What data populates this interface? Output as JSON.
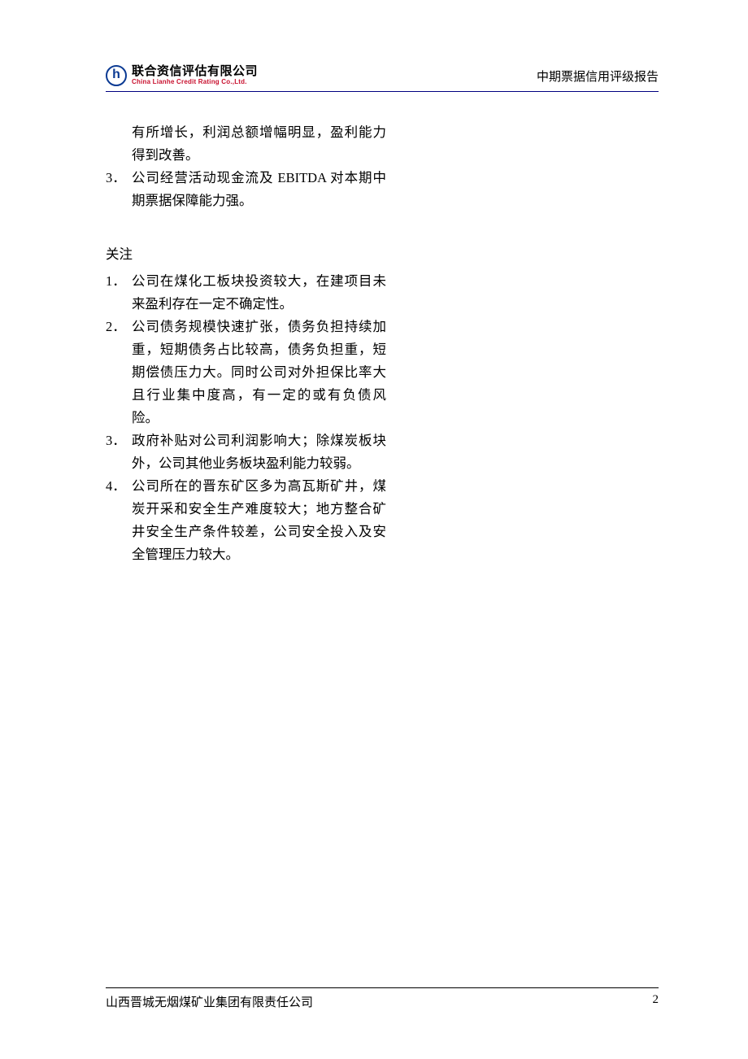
{
  "header": {
    "logo_cn": "联合资信评估有限公司",
    "logo_en": "China Lianhe Credit Rating Co.,Ltd.",
    "right": "中期票据信用评级报告"
  },
  "continued_list": [
    {
      "num": "",
      "text": "有所增长，利润总额增幅明显，盈利能力得到改善。"
    },
    {
      "num": "3．",
      "text": "公司经营活动现金流及 EBITDA 对本期中期票据保障能力强。"
    }
  ],
  "section_title": "关注",
  "concerns": [
    {
      "num": "1．",
      "text": "公司在煤化工板块投资较大，在建项目未来盈利存在一定不确定性。"
    },
    {
      "num": "2．",
      "text": "公司债务规模快速扩张，债务负担持续加重，短期债务占比较高，债务负担重，短期偿债压力大。同时公司对外担保比率大且行业集中度高，有一定的或有负债风险。"
    },
    {
      "num": "3．",
      "text": "政府补贴对公司利润影响大；除煤炭板块外，公司其他业务板块盈利能力较弱。"
    },
    {
      "num": "4．",
      "text": "公司所在的晋东矿区多为高瓦斯矿井，煤炭开采和安全生产难度较大；地方整合矿井安全生产条件较差，公司安全投入及安全管理压力较大。"
    }
  ],
  "footer": {
    "company": "山西晋城无烟煤矿业集团有限责任公司",
    "page": "2"
  }
}
